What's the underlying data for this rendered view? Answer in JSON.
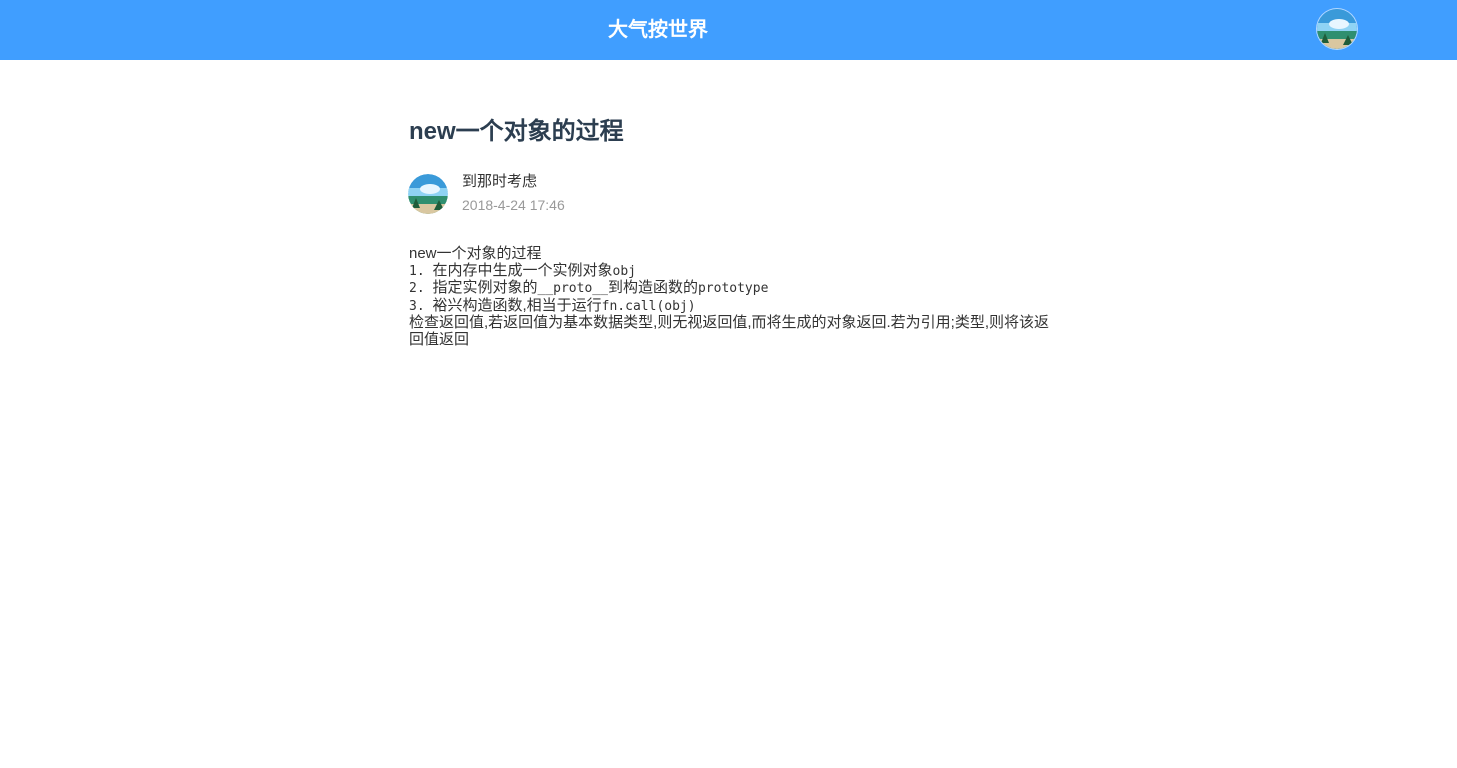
{
  "header": {
    "site_title": "大气按世界",
    "avatar_icon": "user-avatar-icon"
  },
  "article": {
    "title": "new一个对象的过程",
    "author": {
      "name": "到那时考虑",
      "date": "2018-4-24 17:46",
      "avatar_icon": "author-avatar-icon"
    },
    "content": {
      "heading": "new一个对象的过程",
      "steps": [
        {
          "number": "1. ",
          "text": "在内存中生成一个实例对象",
          "code": "obj"
        },
        {
          "number": "2. ",
          "text_before": "指定实例对象的",
          "code_a": "__proto__",
          "text_after": "到构造函数的",
          "code_b": "prototype"
        },
        {
          "number": "3. ",
          "text": "裕兴构造函数,相当于运行",
          "code": "fn.call(obj)"
        }
      ],
      "note": "检查返回值,若返回值为基本数据类型,则无视返回值,而将生成的对象返回.若为引用;类型,则将该返回值返回"
    }
  },
  "colors": {
    "header_bg": "#409eff",
    "title_text": "#2c3e50",
    "meta_date": "#999999"
  }
}
